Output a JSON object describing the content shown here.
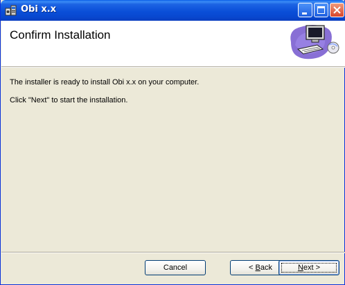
{
  "window": {
    "title": "Obi x.x",
    "icon": "installer-icon",
    "controls": [
      "minimize-icon",
      "maximize-icon",
      "close-icon"
    ]
  },
  "banner": {
    "title": "Confirm Installation",
    "art": "computer-setup-icon"
  },
  "body": {
    "line1": "The installer is ready to install Obi x.x on your computer.",
    "line2": "Click \"Next\" to start the installation."
  },
  "buttons": {
    "cancel": "Cancel",
    "back_prefix": "< ",
    "back_mnemonic": "B",
    "back_rest": "ack",
    "next_mnemonic": "N",
    "next_rest": "ext >"
  },
  "colors": {
    "titlebar": "#0a4fd8",
    "dialog_bg": "#ece9d8",
    "banner_bg": "#ffffff",
    "button_border": "#003c74"
  }
}
